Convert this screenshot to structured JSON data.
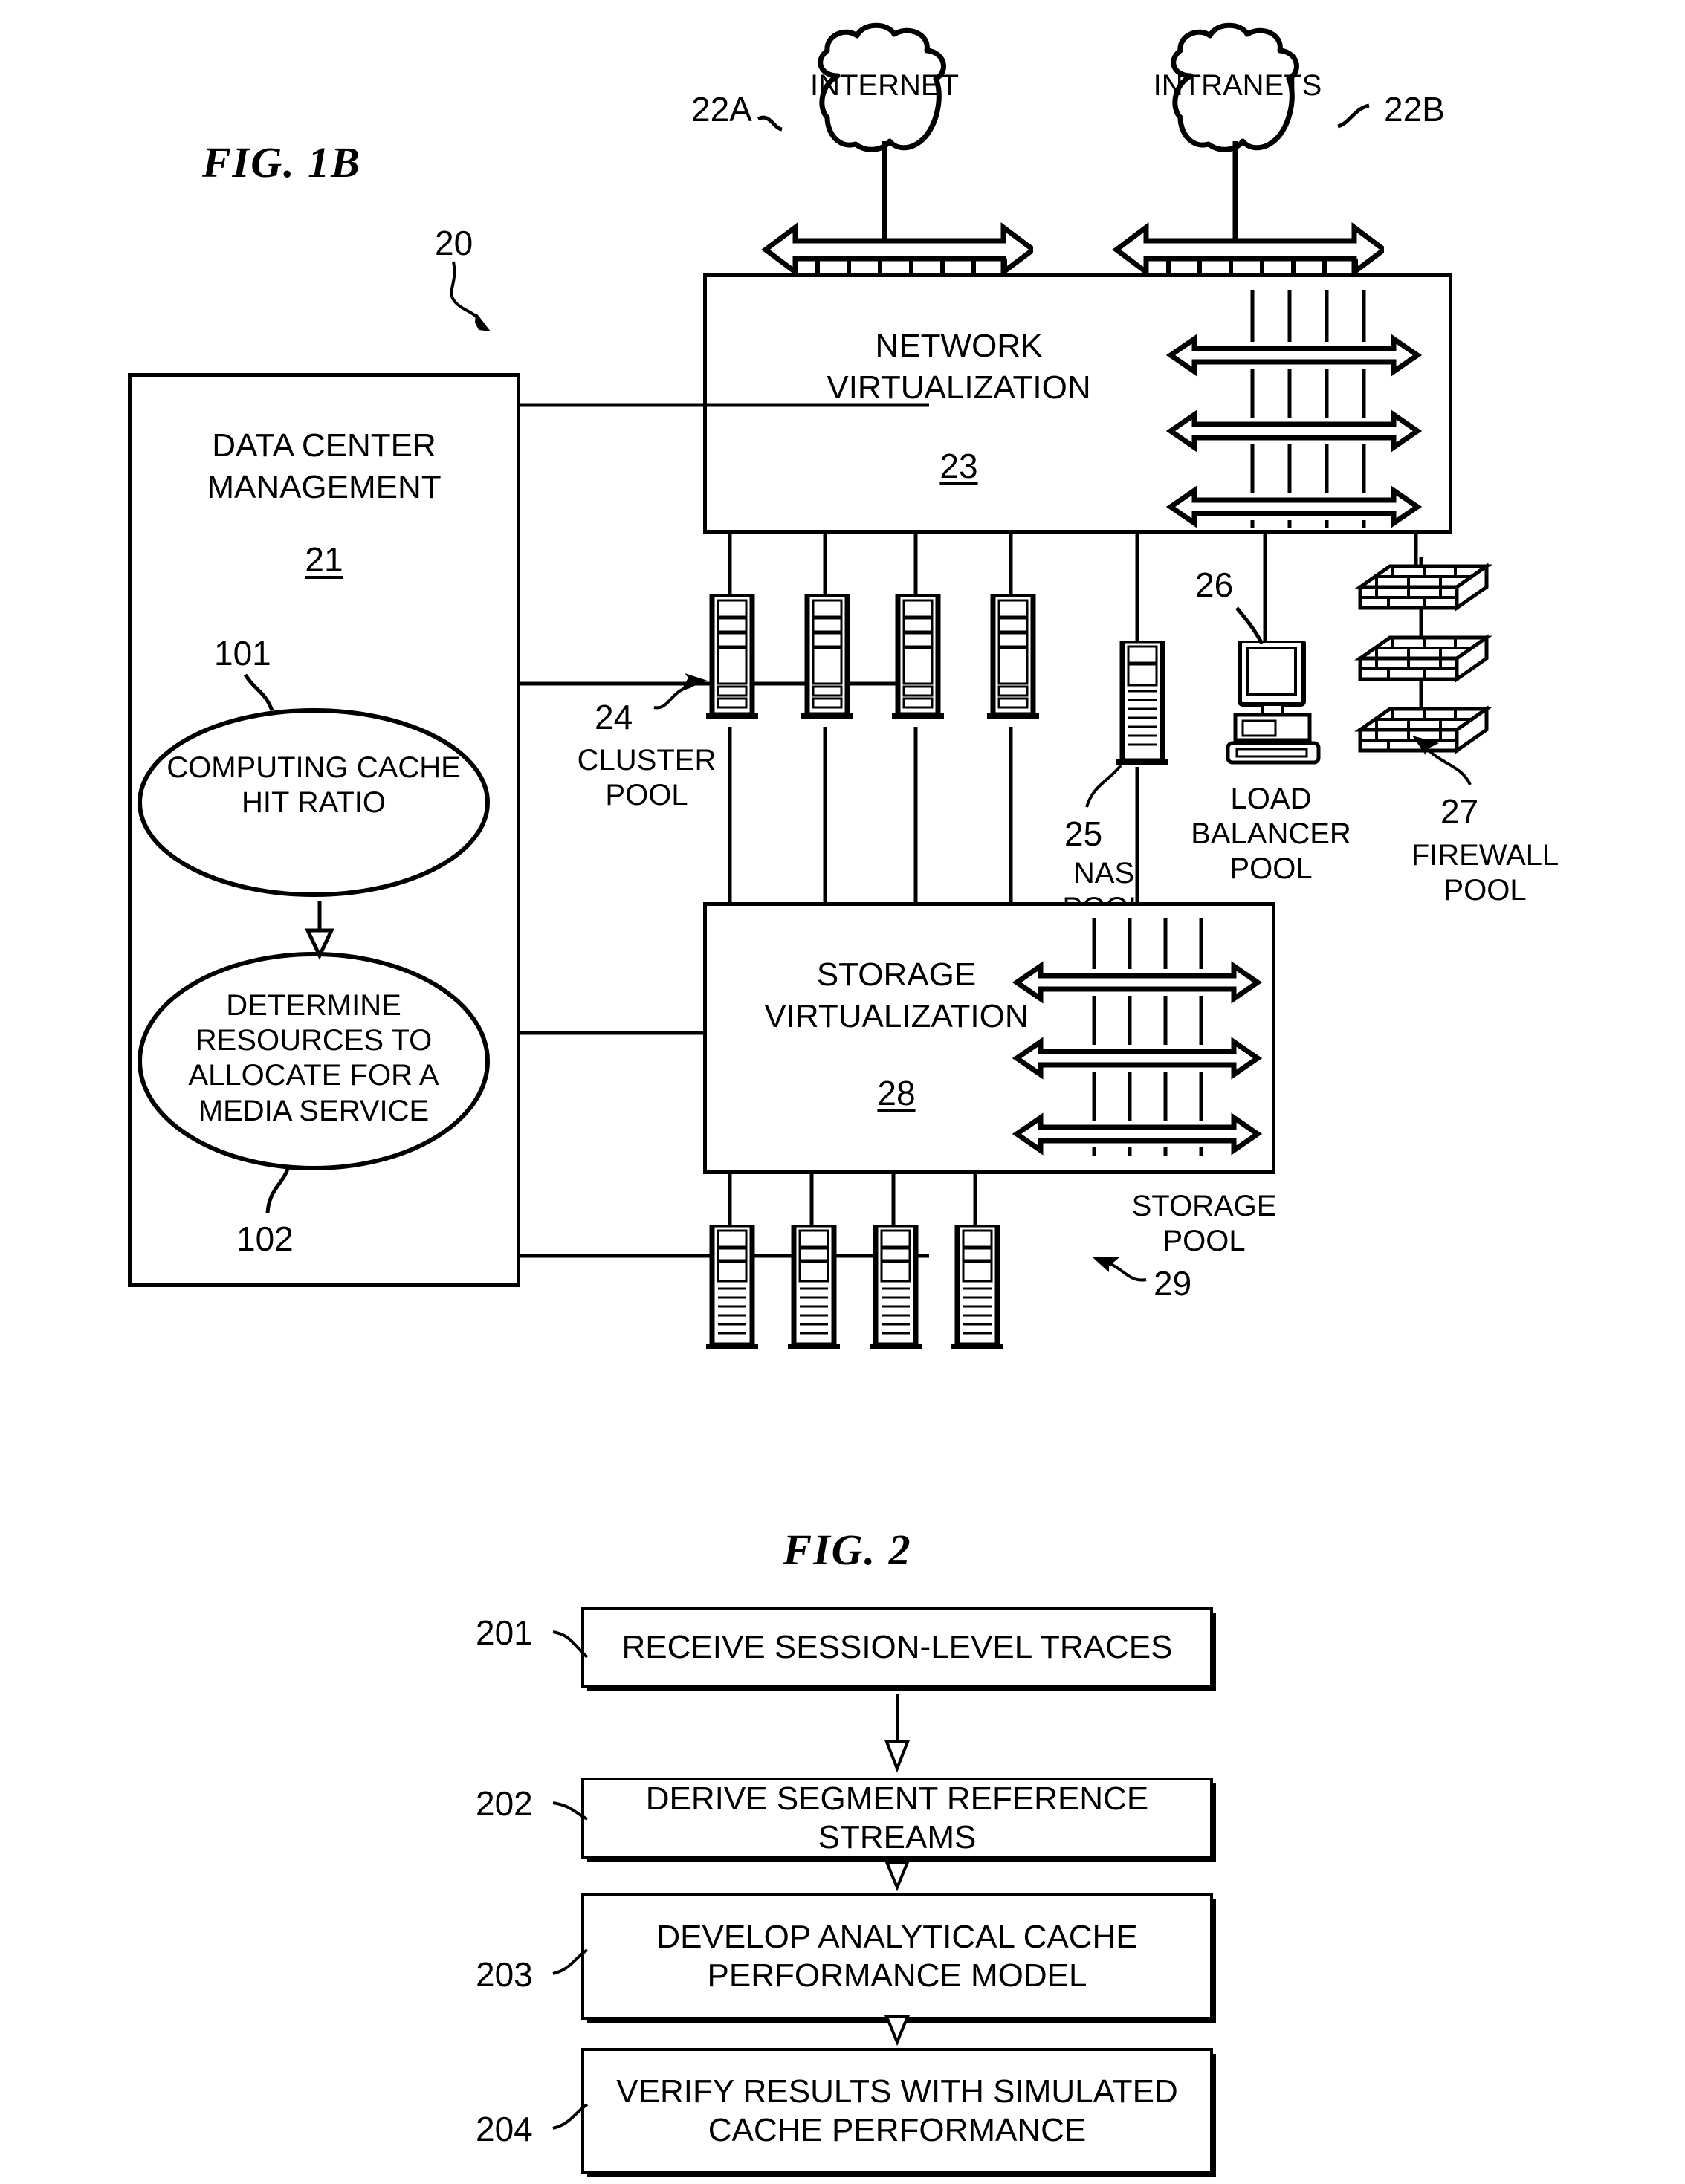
{
  "figures": {
    "fig1b": {
      "title": "FIG. 1B",
      "system_ref": "20",
      "cloud_internet": {
        "label": "INTERNET",
        "ref": "22A"
      },
      "cloud_intranets": {
        "label": "INTRANETS",
        "ref": "22B"
      },
      "data_center_management": {
        "line1": "DATA CENTER",
        "line2": "MANAGEMENT",
        "ref": "21",
        "steps": [
          {
            "ref": "101",
            "text": "COMPUTING CACHE HIT RATIO"
          },
          {
            "ref": "102",
            "text": "DETERMINE RESOURCES TO ALLOCATE FOR A MEDIA SERVICE"
          }
        ]
      },
      "network_virtualization": {
        "line1": "NETWORK",
        "line2": "VIRTUALIZATION",
        "ref": "23"
      },
      "storage_virtualization": {
        "line1": "STORAGE",
        "line2": "VIRTUALIZATION",
        "ref": "28"
      },
      "pools": [
        {
          "ref": "24",
          "line1": "CLUSTER",
          "line2": "POOL",
          "icon": "server-rack-icon",
          "count": 4
        },
        {
          "ref": "25",
          "line1": "NAS",
          "line2": "POOL",
          "icon": "nas-rack-icon",
          "count": 1
        },
        {
          "ref": "26",
          "line1": "LOAD BALANCER",
          "line2": "POOL",
          "icon": "desktop-computer-icon",
          "count": 1
        },
        {
          "ref": "27",
          "line1": "FIREWALL",
          "line2": "POOL",
          "icon": "firewall-brick-icon",
          "count": 3
        },
        {
          "ref": "29",
          "line1": "STORAGE",
          "line2": "POOL",
          "icon": "storage-rack-icon",
          "count": 4
        }
      ]
    },
    "fig2": {
      "title": "FIG. 2",
      "steps": [
        {
          "ref": "201",
          "lines": [
            "RECEIVE SESSION-LEVEL TRACES"
          ]
        },
        {
          "ref": "202",
          "lines": [
            "DERIVE SEGMENT REFERENCE STREAMS"
          ]
        },
        {
          "ref": "203",
          "lines": [
            "DEVELOP ANALYTICAL CACHE",
            "PERFORMANCE MODEL"
          ]
        },
        {
          "ref": "204",
          "lines": [
            "VERIFY RESULTS WITH SIMULATED",
            "CACHE PERFORMANCE"
          ]
        }
      ]
    }
  },
  "colors": {
    "ink": "#000000",
    "paper": "#ffffff"
  }
}
